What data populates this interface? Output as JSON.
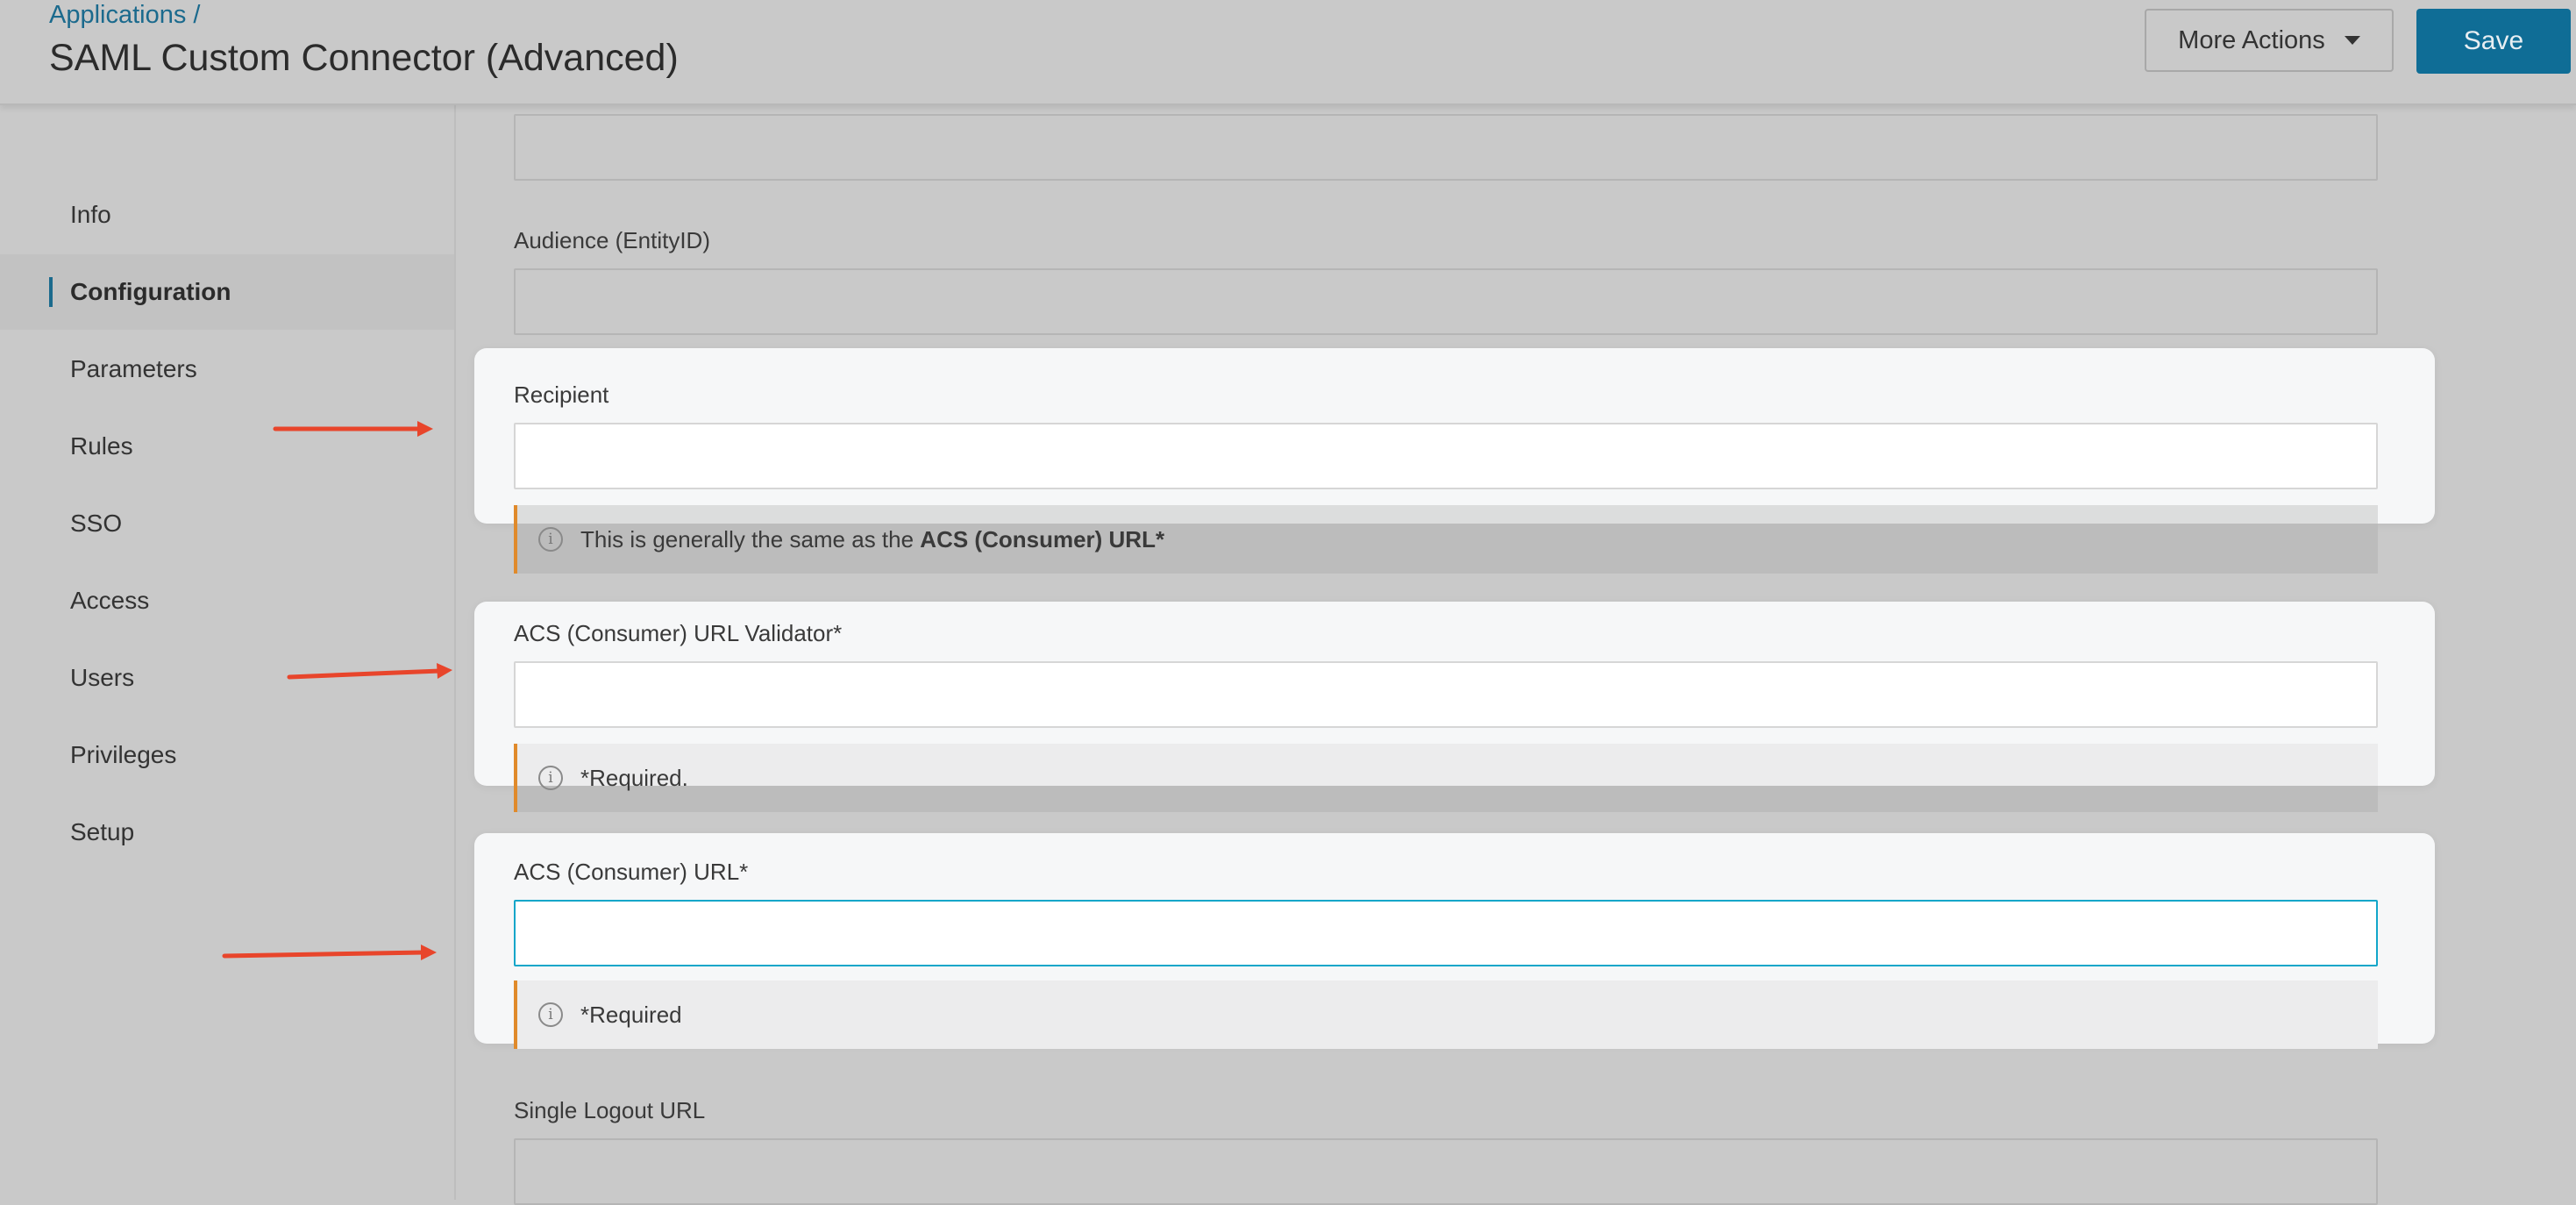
{
  "header": {
    "breadcrumb": "Applications /",
    "title": "SAML Custom Connector (Advanced)",
    "more_actions_label": "More Actions",
    "save_label": "Save"
  },
  "sidebar": {
    "items": [
      {
        "label": "Info",
        "active": false
      },
      {
        "label": "Configuration",
        "active": true
      },
      {
        "label": "Parameters",
        "active": false
      },
      {
        "label": "Rules",
        "active": false
      },
      {
        "label": "SSO",
        "active": false
      },
      {
        "label": "Access",
        "active": false
      },
      {
        "label": "Users",
        "active": false
      },
      {
        "label": "Privileges",
        "active": false
      },
      {
        "label": "Setup",
        "active": false
      }
    ]
  },
  "form": {
    "top_field_value": "",
    "audience": {
      "label": "Audience (EntityID)",
      "value": ""
    },
    "recipient": {
      "label": "Recipient",
      "value": "",
      "note_prefix": "This is generally the same as the ",
      "note_bold": "ACS (Consumer) URL*"
    },
    "acs_validator": {
      "label": "ACS (Consumer) URL Validator*",
      "value": "",
      "note": "*Required."
    },
    "acs_url": {
      "label": "ACS (Consumer) URL*",
      "value": "",
      "note": "*Required"
    },
    "single_logout": {
      "label": "Single Logout URL",
      "value": ""
    }
  },
  "colors": {
    "accent": "#0f6d96",
    "link": "#1b6a8d",
    "annotation_arrow": "#e8452b",
    "warning_border": "#e08a2b",
    "focus_border": "#12a6c9"
  }
}
